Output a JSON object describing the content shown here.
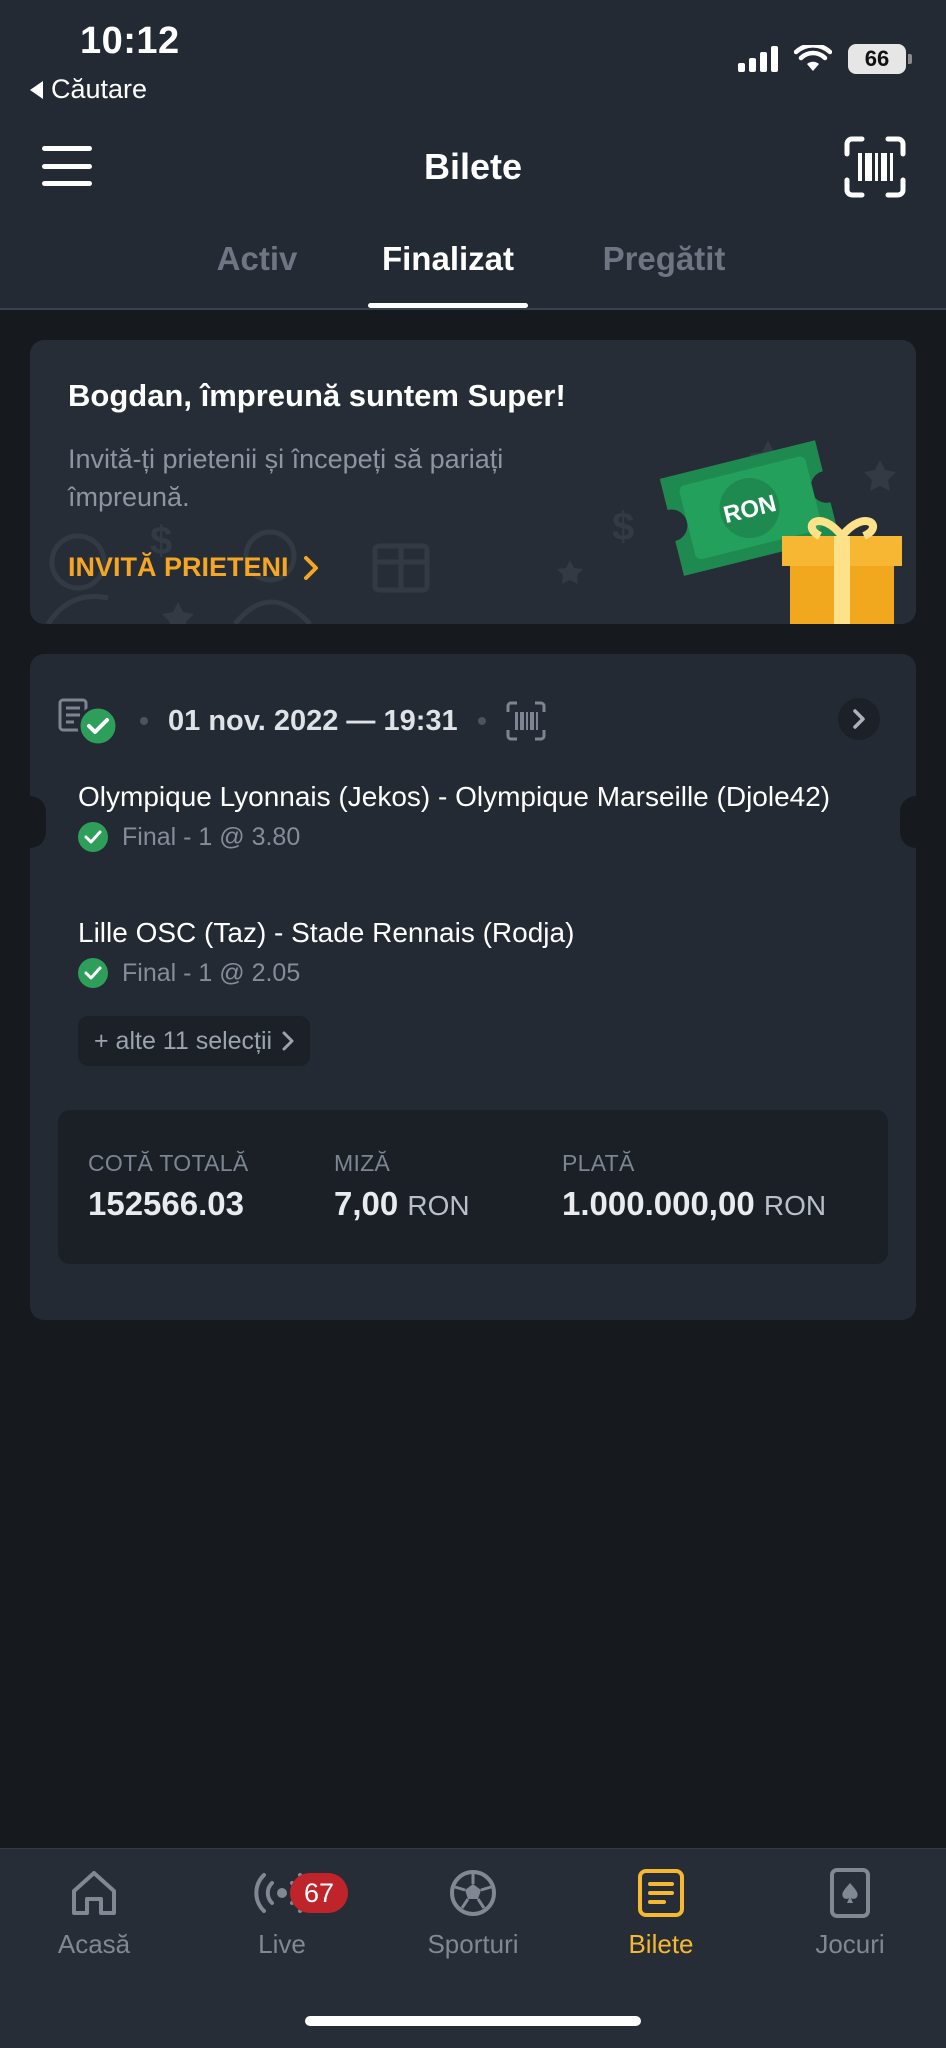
{
  "status_bar": {
    "time": "10:12",
    "back_label": "Căutare",
    "battery": "66"
  },
  "header": {
    "title": "Bilete"
  },
  "tabs": [
    {
      "label": "Activ",
      "active": false
    },
    {
      "label": "Finalizat",
      "active": true
    },
    {
      "label": "Pregătit",
      "active": false
    }
  ],
  "promo": {
    "title": "Bogdan, împreună suntem Super!",
    "description": "Invită-ți prietenii și începeți să pariați împreună.",
    "link_label": "INVITĂ PRIETENI",
    "ticket_text": "RON"
  },
  "ticket": {
    "datetime": "01 nov. 2022 — 19:31",
    "selections": [
      {
        "match": "Olympique Lyonnais (Jekos) - Olympique Marseille (Djole42)",
        "result": "Final - 1 @ 3.80"
      },
      {
        "match": "Lille OSC (Taz) - Stade Rennais (Rodja)",
        "result": "Final - 1 @ 2.05"
      }
    ],
    "more_label": "+ alte 11 selecții",
    "summary": {
      "total_odds_label": "COTĂ TOTALĂ",
      "total_odds_value": "152566.03",
      "stake_label": "MIZĂ",
      "stake_value": "7,00",
      "stake_currency": "RON",
      "payout_label": "PLATĂ",
      "payout_value": "1.000.000,00",
      "payout_currency": "RON"
    }
  },
  "bottom_nav": {
    "items": [
      {
        "label": "Acasă",
        "icon": "home-icon"
      },
      {
        "label": "Live",
        "icon": "live-icon",
        "badge": "67"
      },
      {
        "label": "Sporturi",
        "icon": "soccer-ball-icon"
      },
      {
        "label": "Bilete",
        "icon": "ticket-icon",
        "active": true
      },
      {
        "label": "Jocuri",
        "icon": "cards-icon"
      }
    ]
  },
  "colors": {
    "accent": "#f5b82e",
    "success": "#2e9e5b",
    "badge": "#c0242b",
    "header_bg": "#232a33",
    "page_bg": "#161a1f"
  }
}
